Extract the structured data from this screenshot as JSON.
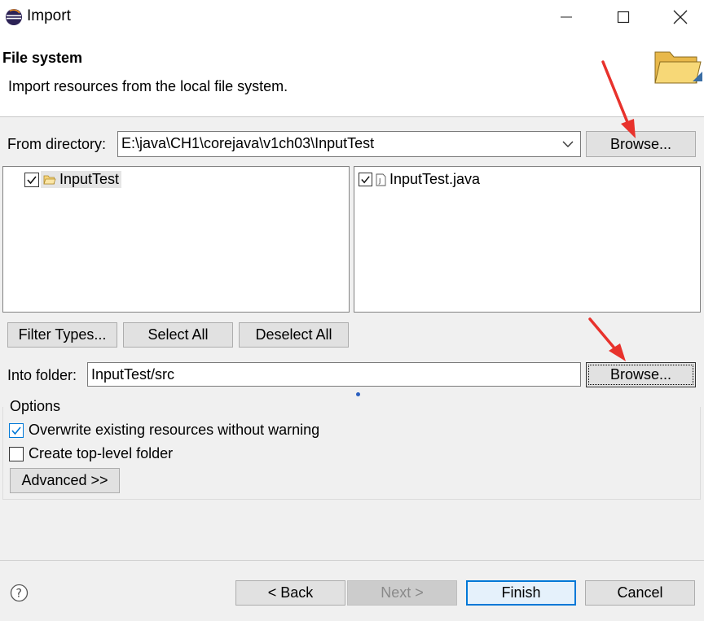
{
  "window": {
    "title": "Import",
    "minimize_icon": "minimize-icon",
    "maximize_icon": "maximize-icon",
    "close_icon": "close-icon"
  },
  "header": {
    "title": "File system",
    "description": "Import resources from the local file system.",
    "icon": "folder-icon"
  },
  "source": {
    "label": "From directory:",
    "value": "E:\\java\\CH1\\corejava\\v1ch03\\InputTest",
    "browse_label": "Browse..."
  },
  "folders": [
    {
      "label": "InputTest",
      "checked": true
    }
  ],
  "files": [
    {
      "label": "InputTest.java",
      "checked": true
    }
  ],
  "selection_buttons": {
    "filter_types": "Filter Types...",
    "select_all": "Select All",
    "deselect_all": "Deselect All"
  },
  "destination": {
    "label": "Into folder:",
    "value": "InputTest/src",
    "browse_label": "Browse..."
  },
  "options": {
    "title": "Options",
    "overwrite_label": "Overwrite existing resources without warning",
    "overwrite_checked": true,
    "create_top_level_label": "Create top-level folder",
    "create_top_level_checked": false,
    "advanced_label": "Advanced >>"
  },
  "footer": {
    "help_icon": "help-icon",
    "back_label": "< Back",
    "next_label": "Next >",
    "finish_label": "Finish",
    "cancel_label": "Cancel"
  },
  "colors": {
    "accent": "#0078d7",
    "annotation_arrow": "#e8322c"
  }
}
